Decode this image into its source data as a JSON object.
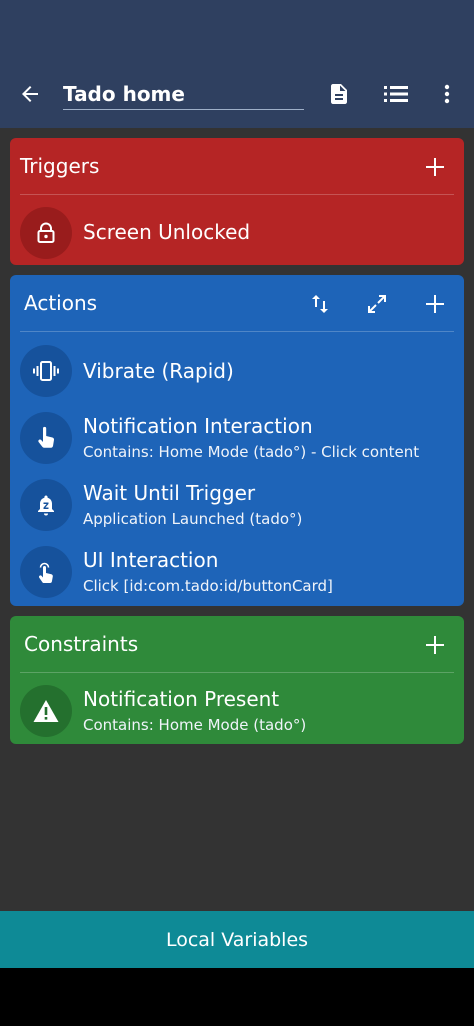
{
  "app_bar": {
    "title": "Tado home",
    "icons": [
      "back-arrow-icon",
      "document-icon",
      "list-icon",
      "more-vertical-icon"
    ]
  },
  "triggers": {
    "title": "Triggers",
    "items": [
      {
        "title": "Screen Unlocked",
        "icon": "lock-icon"
      }
    ]
  },
  "actions": {
    "title": "Actions",
    "items": [
      {
        "title": "Vibrate (Rapid)",
        "subtitle": "",
        "icon": "vibrate-icon"
      },
      {
        "title": "Notification Interaction",
        "subtitle": "Contains: Home Mode (tado°) - Click content",
        "icon": "touch-icon"
      },
      {
        "title": "Wait Until Trigger",
        "subtitle": "Application Launched (tado°)",
        "icon": "bell-z-icon"
      },
      {
        "title": "UI Interaction",
        "subtitle": "Click [id:com.tado:id/buttonCard]",
        "icon": "tap-icon"
      }
    ]
  },
  "constraints": {
    "title": "Constraints",
    "items": [
      {
        "title": "Notification Present",
        "subtitle": "Contains: Home Mode (tado°)",
        "icon": "warning-icon"
      }
    ]
  },
  "bottom_bar": {
    "label": "Local Variables"
  },
  "colors": {
    "app_bar": "#2f4060",
    "triggers": "#b52525",
    "actions": "#1e64b8",
    "constraints": "#2f8a3a",
    "bottom_bar": "#0e8a96",
    "background": "#333333"
  }
}
